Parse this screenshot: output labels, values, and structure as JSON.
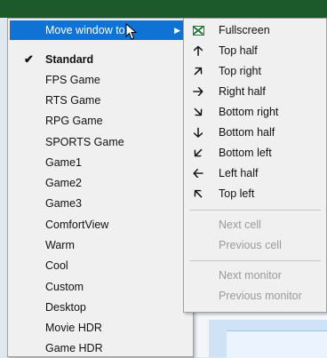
{
  "main_menu": {
    "move_window_label": "Move window to",
    "items": [
      {
        "label": "Standard",
        "checked": true
      },
      {
        "label": "FPS Game"
      },
      {
        "label": "RTS Game"
      },
      {
        "label": "RPG Game"
      },
      {
        "label": "SPORTS Game"
      },
      {
        "label": "Game1"
      },
      {
        "label": "Game2"
      },
      {
        "label": "Game3"
      },
      {
        "label": "ComfortView"
      },
      {
        "label": "Warm"
      },
      {
        "label": "Cool"
      },
      {
        "label": "Custom"
      },
      {
        "label": "Desktop"
      },
      {
        "label": "Movie HDR"
      },
      {
        "label": "Game HDR"
      }
    ]
  },
  "submenu": {
    "items": [
      {
        "label": "Fullscreen",
        "icon": "fullscreen-icon"
      },
      {
        "label": "Top half",
        "icon": "arrow-up-icon"
      },
      {
        "label": "Top right",
        "icon": "arrow-up-right-icon"
      },
      {
        "label": "Right half",
        "icon": "arrow-right-icon"
      },
      {
        "label": "Bottom right",
        "icon": "arrow-down-right-icon"
      },
      {
        "label": "Bottom half",
        "icon": "arrow-down-icon"
      },
      {
        "label": "Bottom left",
        "icon": "arrow-down-left-icon"
      },
      {
        "label": "Left half",
        "icon": "arrow-left-icon"
      },
      {
        "label": "Top left",
        "icon": "arrow-up-left-icon"
      }
    ],
    "cell_items": [
      {
        "label": "Next cell"
      },
      {
        "label": "Previous cell"
      }
    ],
    "monitor_items": [
      {
        "label": "Next monitor"
      },
      {
        "label": "Previous monitor"
      }
    ]
  },
  "colors": {
    "highlight": "#0f73d6",
    "menu_bg": "#f0f0f0",
    "disabled_text": "#9a9a9a"
  }
}
